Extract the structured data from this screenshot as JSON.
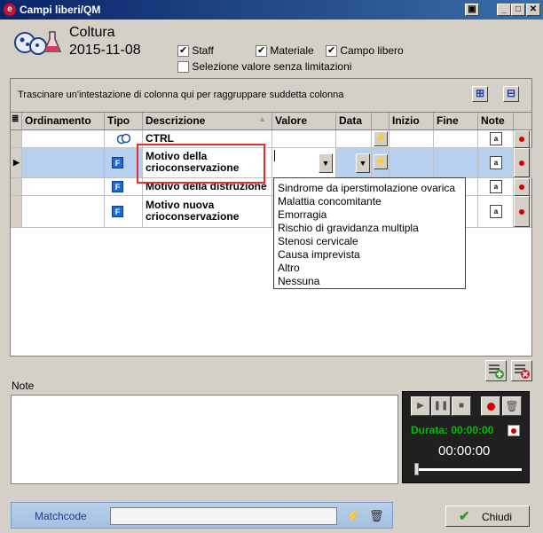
{
  "window": {
    "title": "Campi liberi/QM"
  },
  "header": {
    "title": "Coltura",
    "date": "2015-11-08"
  },
  "filters": {
    "staff": {
      "label": "Staff",
      "checked": true
    },
    "materiale": {
      "label": "Materiale",
      "checked": true
    },
    "campo_libero": {
      "label": "Campo libero",
      "checked": true
    },
    "selezione": {
      "label": "Selezione valore senza limitazioni",
      "checked": false
    }
  },
  "grid": {
    "group_hint": "Trascinare un'intestazione di colonna qui per raggruppare suddetta colonna",
    "columns": [
      "Ordinamento",
      "Tipo",
      "Descrizione",
      "Valore",
      "Data",
      "Inizio",
      "Fine",
      "Note"
    ],
    "rows": [
      {
        "tipo_icon": "group-type-icon",
        "descrizione": "CTRL",
        "selected": false
      },
      {
        "tipo_icon": "f-type-icon",
        "descrizione": "Motivo della crioconservazione",
        "selected": true
      },
      {
        "tipo_icon": "f-type-icon",
        "descrizione": "Motivo della distruzione",
        "selected": false
      },
      {
        "tipo_icon": "f-type-icon",
        "descrizione": "Motivo nuova crioconservazione",
        "selected": false
      }
    ]
  },
  "dropdown": {
    "options": [
      "Sindrome da iperstimolazione ovarica",
      "Malattia concomitante",
      "Emorragia",
      "Rischio di gravidanza multipla",
      "Stenosi cervicale",
      "Causa imprevista",
      "Altro",
      "Nessuna"
    ]
  },
  "notes": {
    "label": "Note",
    "value": ""
  },
  "recorder": {
    "duration_label": "Durata: 00:00:00",
    "time": "00:00:00"
  },
  "footer": {
    "matchcode_label": "Matchcode",
    "matchcode_value": "",
    "close_label": "Chiudi"
  },
  "colors": {
    "titlebar": "#0a246a",
    "selection": "#b8d0f0",
    "record": "#d40000",
    "duration": "#00c000"
  }
}
